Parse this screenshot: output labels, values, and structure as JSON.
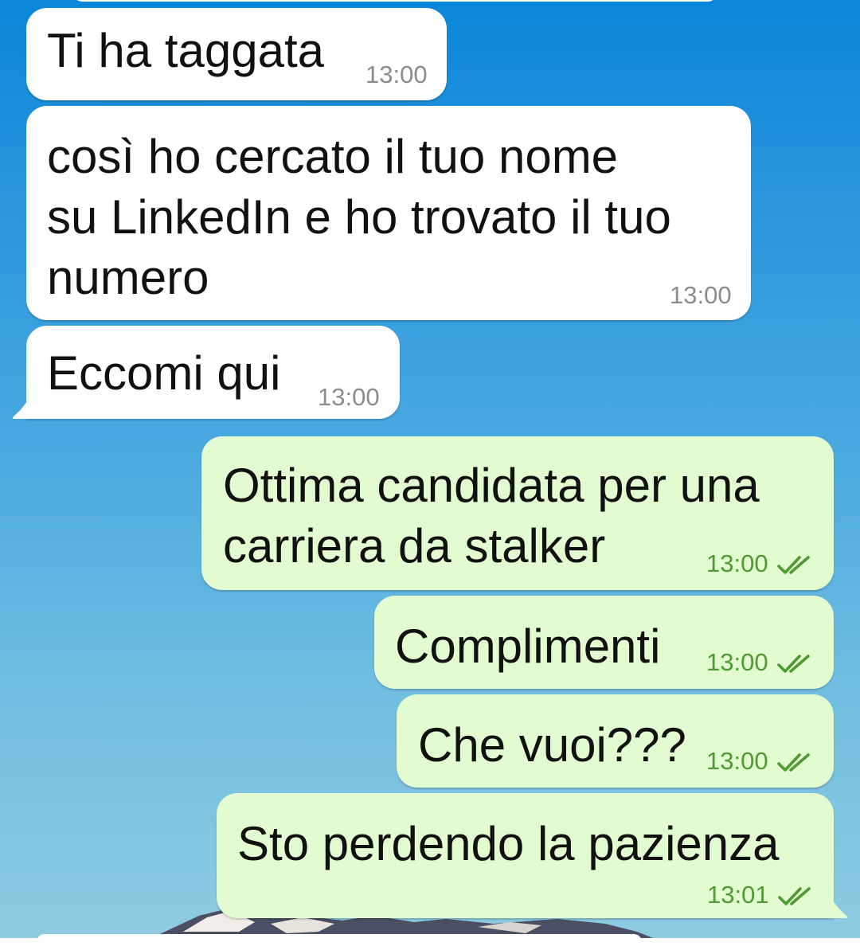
{
  "chat": {
    "messages": [
      {
        "direction": "incoming",
        "text": "Ti ha taggata",
        "time": "13:00"
      },
      {
        "direction": "incoming",
        "text_lines": [
          "così ho cercato il tuo nome",
          "su LinkedIn e ho trovato il tuo",
          "numero"
        ],
        "time": "13:00"
      },
      {
        "direction": "incoming",
        "text": "Eccomi qui",
        "time": "13:00"
      },
      {
        "direction": "outgoing",
        "text_lines": [
          "Ottima candidata per una",
          "carriera da stalker"
        ],
        "time": "13:00",
        "status": "read"
      },
      {
        "direction": "outgoing",
        "text": "Complimenti",
        "time": "13:00",
        "status": "read"
      },
      {
        "direction": "outgoing",
        "text": "Che vuoi???",
        "time": "13:00",
        "status": "read"
      },
      {
        "direction": "outgoing",
        "text": "Sto perdendo la pazienza",
        "time": "13:01",
        "status": "read"
      }
    ]
  },
  "icons": {
    "read_status": "double-check-icon"
  },
  "colors": {
    "incoming_bubble": "#ffffff",
    "outgoing_bubble": "#e2fbd0",
    "outgoing_meta": "#4f9a33",
    "incoming_meta": "#8c8c8c",
    "wallpaper_top": "#0b86d8",
    "wallpaper_bottom": "#8fcbe0"
  }
}
